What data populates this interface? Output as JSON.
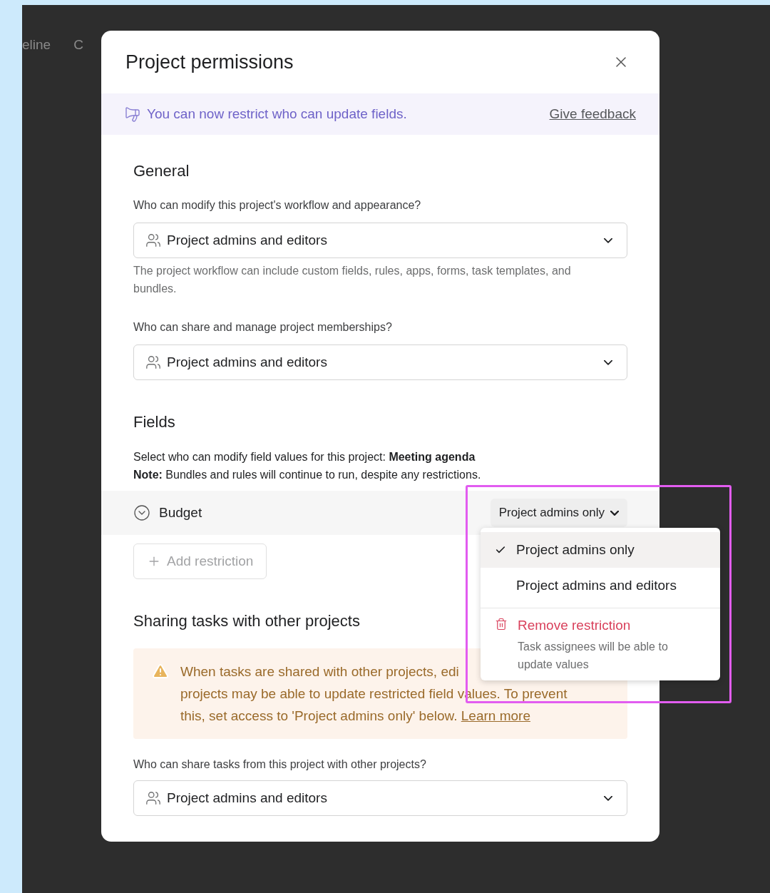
{
  "background": {
    "tab_labels": [
      "eline",
      "C"
    ]
  },
  "dialog": {
    "title": "Project permissions",
    "banner": {
      "text": "You can now restrict who can update fields.",
      "link": "Give feedback"
    },
    "general": {
      "heading": "General",
      "settings": [
        {
          "question": "Who can modify this project's workflow and appearance?",
          "value": "Project admins and editors",
          "help": "The project workflow can include custom fields, rules, apps, forms, task templates, and bundles."
        },
        {
          "question": "Who can share and manage project memberships?",
          "value": "Project admins and editors"
        }
      ]
    },
    "fields": {
      "heading": "Fields",
      "description": "Select who can modify field values for this project: **Meeting agenda**",
      "note": "**Note:** Bundles and rules will continue to run, despite any restrictions.",
      "restrictions": [
        {
          "field": "Budget",
          "access": "Project admins only",
          "expanded": true
        }
      ],
      "add_button": "Add restriction"
    },
    "sharing": {
      "heading": "Sharing tasks with other projects",
      "warning": {
        "lines": [
          "When tasks are shared with other projects, edi",
          "projects may be able to update restricted field values. To prevent",
          "this, set access to 'Project admins only' below."
        ],
        "link": "Learn more"
      },
      "question": "Who can share tasks from this project with other projects?",
      "value": "Project admins and editors"
    }
  },
  "menu": {
    "options": [
      {
        "label": "Project admins only",
        "selected": true
      },
      {
        "label": "Project admins and editors",
        "selected": false
      }
    ],
    "remove": {
      "label": "Remove restriction",
      "description": "Task assignees will be able to update values"
    }
  }
}
